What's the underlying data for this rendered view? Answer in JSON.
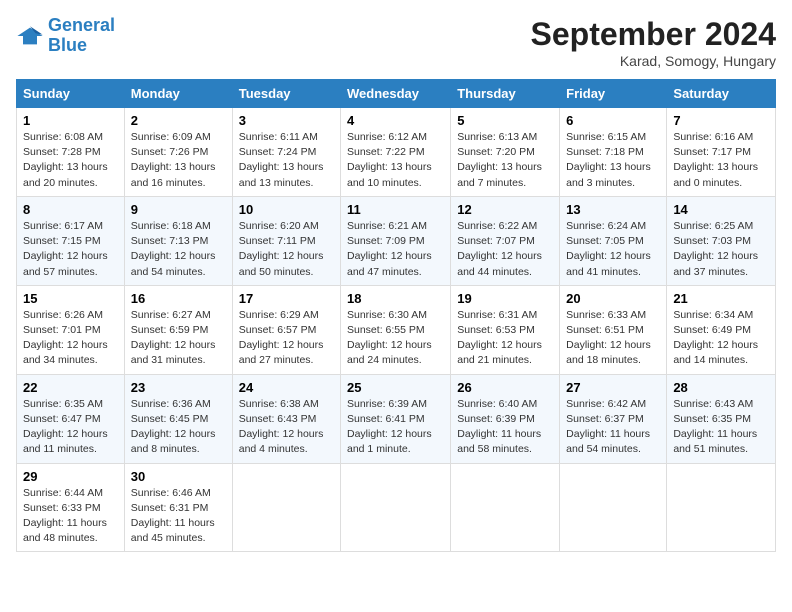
{
  "logo": {
    "line1": "General",
    "line2": "Blue"
  },
  "title": "September 2024",
  "subtitle": "Karad, Somogy, Hungary",
  "days_of_week": [
    "Sunday",
    "Monday",
    "Tuesday",
    "Wednesday",
    "Thursday",
    "Friday",
    "Saturday"
  ],
  "weeks": [
    [
      {
        "day": "1",
        "sunrise": "6:08 AM",
        "sunset": "7:28 PM",
        "daylight": "13 hours and 20 minutes."
      },
      {
        "day": "2",
        "sunrise": "6:09 AM",
        "sunset": "7:26 PM",
        "daylight": "13 hours and 16 minutes."
      },
      {
        "day": "3",
        "sunrise": "6:11 AM",
        "sunset": "7:24 PM",
        "daylight": "13 hours and 13 minutes."
      },
      {
        "day": "4",
        "sunrise": "6:12 AM",
        "sunset": "7:22 PM",
        "daylight": "13 hours and 10 minutes."
      },
      {
        "day": "5",
        "sunrise": "6:13 AM",
        "sunset": "7:20 PM",
        "daylight": "13 hours and 7 minutes."
      },
      {
        "day": "6",
        "sunrise": "6:15 AM",
        "sunset": "7:18 PM",
        "daylight": "13 hours and 3 minutes."
      },
      {
        "day": "7",
        "sunrise": "6:16 AM",
        "sunset": "7:17 PM",
        "daylight": "13 hours and 0 minutes."
      }
    ],
    [
      {
        "day": "8",
        "sunrise": "6:17 AM",
        "sunset": "7:15 PM",
        "daylight": "12 hours and 57 minutes."
      },
      {
        "day": "9",
        "sunrise": "6:18 AM",
        "sunset": "7:13 PM",
        "daylight": "12 hours and 54 minutes."
      },
      {
        "day": "10",
        "sunrise": "6:20 AM",
        "sunset": "7:11 PM",
        "daylight": "12 hours and 50 minutes."
      },
      {
        "day": "11",
        "sunrise": "6:21 AM",
        "sunset": "7:09 PM",
        "daylight": "12 hours and 47 minutes."
      },
      {
        "day": "12",
        "sunrise": "6:22 AM",
        "sunset": "7:07 PM",
        "daylight": "12 hours and 44 minutes."
      },
      {
        "day": "13",
        "sunrise": "6:24 AM",
        "sunset": "7:05 PM",
        "daylight": "12 hours and 41 minutes."
      },
      {
        "day": "14",
        "sunrise": "6:25 AM",
        "sunset": "7:03 PM",
        "daylight": "12 hours and 37 minutes."
      }
    ],
    [
      {
        "day": "15",
        "sunrise": "6:26 AM",
        "sunset": "7:01 PM",
        "daylight": "12 hours and 34 minutes."
      },
      {
        "day": "16",
        "sunrise": "6:27 AM",
        "sunset": "6:59 PM",
        "daylight": "12 hours and 31 minutes."
      },
      {
        "day": "17",
        "sunrise": "6:29 AM",
        "sunset": "6:57 PM",
        "daylight": "12 hours and 27 minutes."
      },
      {
        "day": "18",
        "sunrise": "6:30 AM",
        "sunset": "6:55 PM",
        "daylight": "12 hours and 24 minutes."
      },
      {
        "day": "19",
        "sunrise": "6:31 AM",
        "sunset": "6:53 PM",
        "daylight": "12 hours and 21 minutes."
      },
      {
        "day": "20",
        "sunrise": "6:33 AM",
        "sunset": "6:51 PM",
        "daylight": "12 hours and 18 minutes."
      },
      {
        "day": "21",
        "sunrise": "6:34 AM",
        "sunset": "6:49 PM",
        "daylight": "12 hours and 14 minutes."
      }
    ],
    [
      {
        "day": "22",
        "sunrise": "6:35 AM",
        "sunset": "6:47 PM",
        "daylight": "12 hours and 11 minutes."
      },
      {
        "day": "23",
        "sunrise": "6:36 AM",
        "sunset": "6:45 PM",
        "daylight": "12 hours and 8 minutes."
      },
      {
        "day": "24",
        "sunrise": "6:38 AM",
        "sunset": "6:43 PM",
        "daylight": "12 hours and 4 minutes."
      },
      {
        "day": "25",
        "sunrise": "6:39 AM",
        "sunset": "6:41 PM",
        "daylight": "12 hours and 1 minute."
      },
      {
        "day": "26",
        "sunrise": "6:40 AM",
        "sunset": "6:39 PM",
        "daylight": "11 hours and 58 minutes."
      },
      {
        "day": "27",
        "sunrise": "6:42 AM",
        "sunset": "6:37 PM",
        "daylight": "11 hours and 54 minutes."
      },
      {
        "day": "28",
        "sunrise": "6:43 AM",
        "sunset": "6:35 PM",
        "daylight": "11 hours and 51 minutes."
      }
    ],
    [
      {
        "day": "29",
        "sunrise": "6:44 AM",
        "sunset": "6:33 PM",
        "daylight": "11 hours and 48 minutes."
      },
      {
        "day": "30",
        "sunrise": "6:46 AM",
        "sunset": "6:31 PM",
        "daylight": "11 hours and 45 minutes."
      },
      null,
      null,
      null,
      null,
      null
    ]
  ],
  "labels": {
    "sunrise": "Sunrise:",
    "sunset": "Sunset:",
    "daylight": "Daylight:"
  }
}
